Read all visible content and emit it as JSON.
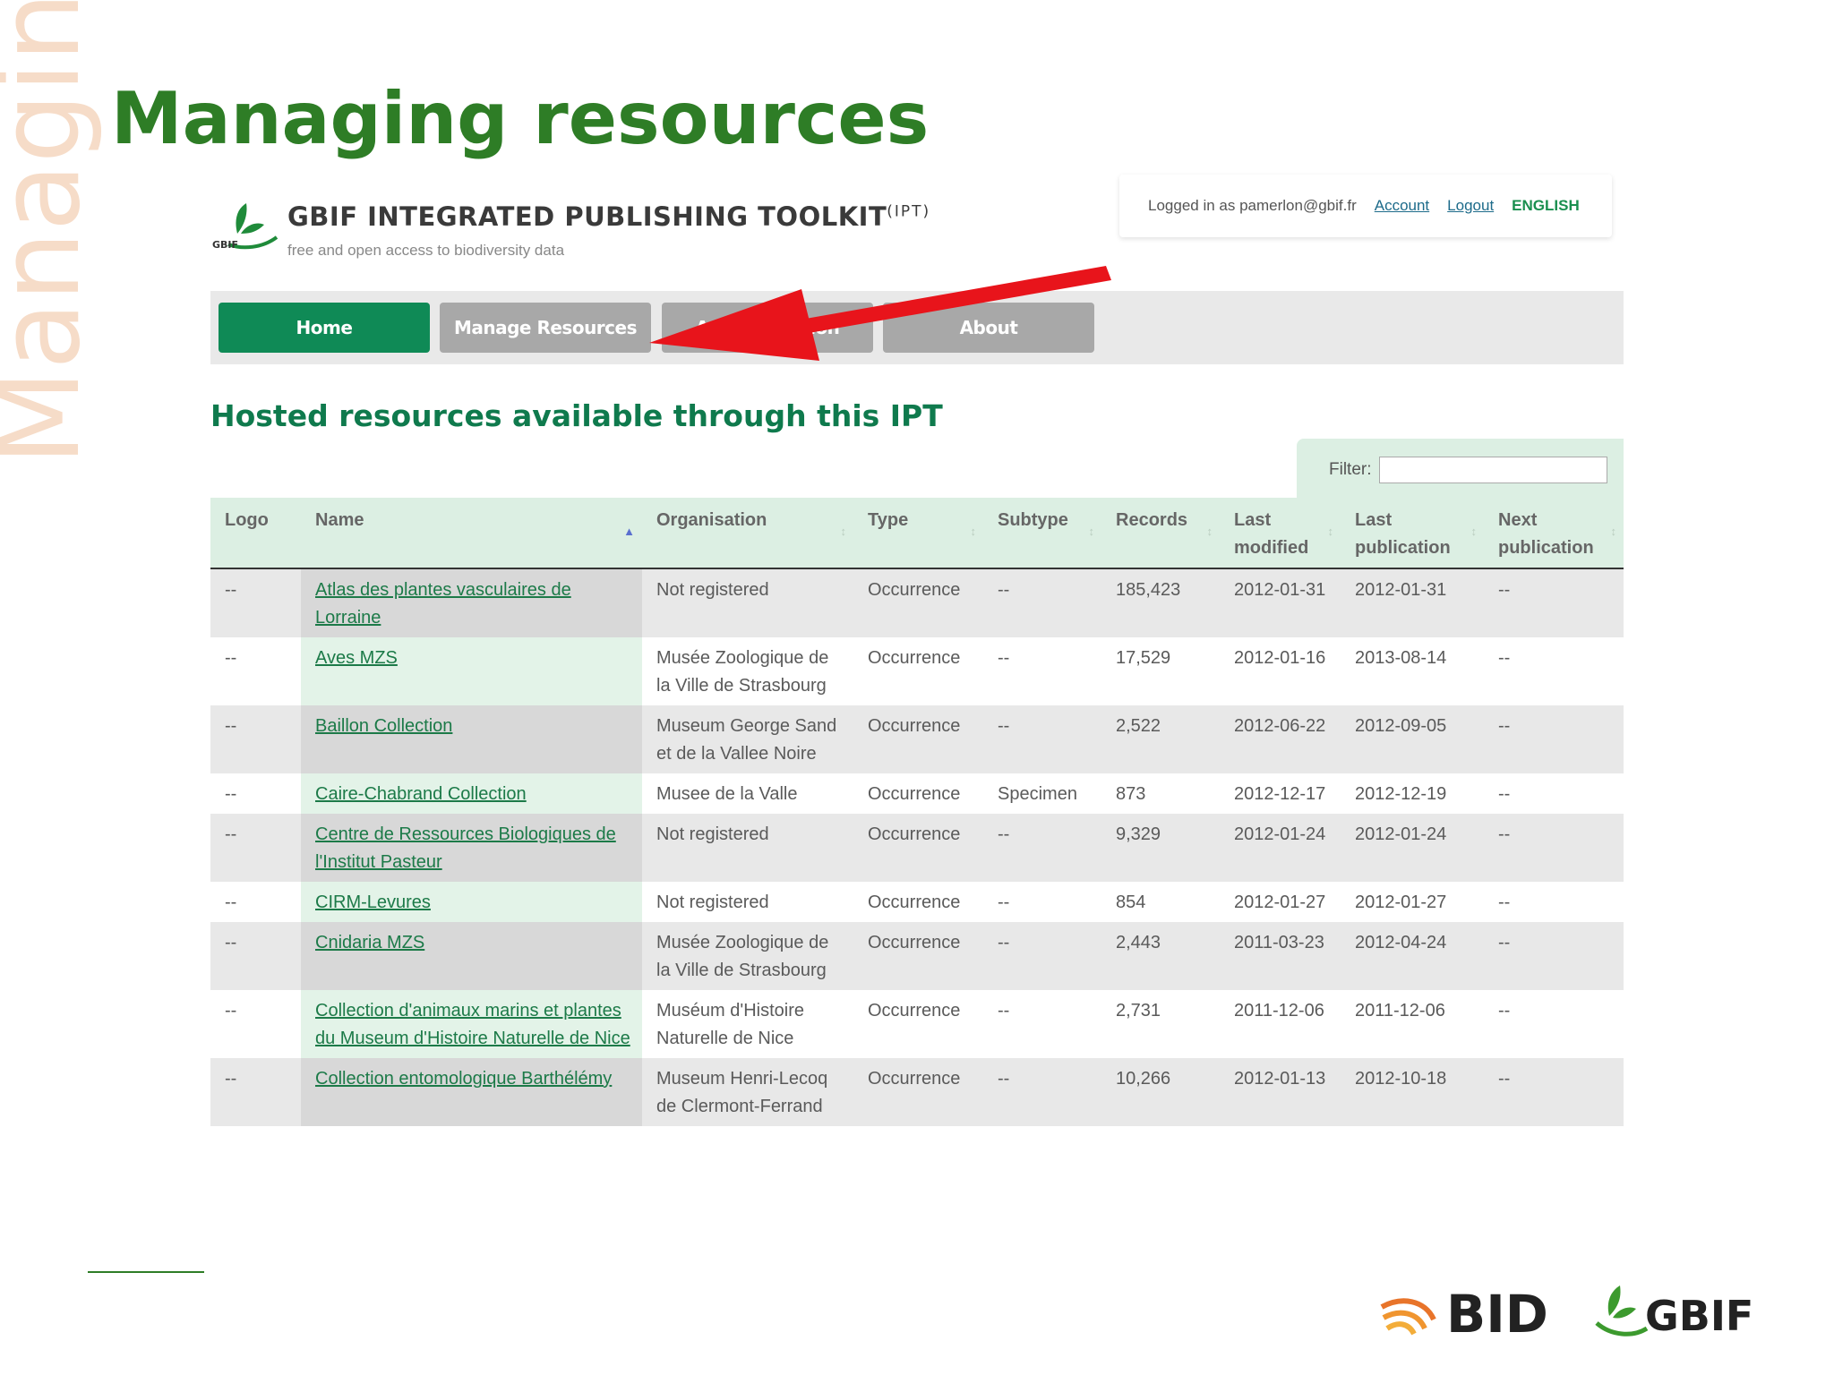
{
  "slide": {
    "vertical_word": "Managing",
    "title": "Managing resources"
  },
  "ipt": {
    "logo_text": "GBIF",
    "title": "GBIF INTEGRATED PUBLISHING TOOLKIT",
    "title_sup": "(IPT)",
    "tagline": "free and open access to biodiversity data",
    "login": {
      "logged_in_text": "Logged in as pamerlon@gbif.fr",
      "account_label": "Account",
      "logout_label": "Logout",
      "language_label": "ENGLISH"
    },
    "nav": [
      {
        "label": "Home",
        "active": true
      },
      {
        "label": "Manage Resources",
        "active": false
      },
      {
        "label": "Administration",
        "active": false
      },
      {
        "label": "About",
        "active": false
      }
    ],
    "section_heading": "Hosted resources available through this IPT",
    "filter_label": "Filter:",
    "filter_value": "",
    "table": {
      "columns": [
        "Logo",
        "Name",
        "Organisation",
        "Type",
        "Subtype",
        "Records",
        "Last modified",
        "Last publication",
        "Next publication"
      ],
      "rows": [
        {
          "logo": "--",
          "name": "Atlas des plantes vasculaires de Lorraine",
          "organisation": "Not registered",
          "type": "Occurrence",
          "subtype": "--",
          "records": "185,423",
          "last_modified": "2012-01-31",
          "last_publication": "2012-01-31",
          "next_publication": "--"
        },
        {
          "logo": "--",
          "name": "Aves MZS",
          "organisation": "Musée Zoologique de la Ville de Strasbourg",
          "type": "Occurrence",
          "subtype": "--",
          "records": "17,529",
          "last_modified": "2012-01-16",
          "last_publication": "2013-08-14",
          "next_publication": "--"
        },
        {
          "logo": "--",
          "name": "Baillon Collection",
          "organisation": "Museum George Sand et de la Vallee Noire",
          "type": "Occurrence",
          "subtype": "--",
          "records": "2,522",
          "last_modified": "2012-06-22",
          "last_publication": "2012-09-05",
          "next_publication": "--"
        },
        {
          "logo": "--",
          "name": "Caire-Chabrand Collection",
          "organisation": "Musee de la Valle",
          "type": "Occurrence",
          "subtype": "Specimen",
          "records": "873",
          "last_modified": "2012-12-17",
          "last_publication": "2012-12-19",
          "next_publication": "--"
        },
        {
          "logo": "--",
          "name": "Centre de Ressources Biologiques de l'Institut Pasteur",
          "organisation": "Not registered",
          "type": "Occurrence",
          "subtype": "--",
          "records": "9,329",
          "last_modified": "2012-01-24",
          "last_publication": "2012-01-24",
          "next_publication": "--"
        },
        {
          "logo": "--",
          "name": "CIRM-Levures",
          "organisation": "Not registered",
          "type": "Occurrence",
          "subtype": "--",
          "records": "854",
          "last_modified": "2012-01-27",
          "last_publication": "2012-01-27",
          "next_publication": "--"
        },
        {
          "logo": "--",
          "name": "Cnidaria MZS",
          "organisation": "Musée Zoologique de la Ville de Strasbourg",
          "type": "Occurrence",
          "subtype": "--",
          "records": "2,443",
          "last_modified": "2011-03-23",
          "last_publication": "2012-04-24",
          "next_publication": "--"
        },
        {
          "logo": "--",
          "name": "Collection d'animaux marins et plantes du Museum d'Histoire Naturelle de Nice",
          "organisation": "Muséum d'Histoire Naturelle de Nice",
          "type": "Occurrence",
          "subtype": "--",
          "records": "2,731",
          "last_modified": "2011-12-06",
          "last_publication": "2011-12-06",
          "next_publication": "--"
        },
        {
          "logo": "--",
          "name": "Collection entomologique Barthélémy",
          "organisation": "Museum Henri-Lecoq de Clermont-Ferrand",
          "type": "Occurrence",
          "subtype": "--",
          "records": "10,266",
          "last_modified": "2012-01-13",
          "last_publication": "2012-10-18",
          "next_publication": "--"
        }
      ]
    }
  },
  "footer": {
    "bid_logo_text": "BID",
    "gbif_logo_text": "GBIF"
  },
  "colors": {
    "title_green": "#2e7d26",
    "nav_active": "#0f8a56",
    "nav_inactive": "#a8a8a8",
    "heading_green": "#0f7a4d",
    "link_green": "#1c7a48",
    "arrow_red": "#e8141b",
    "header_bg": "#dcefe3"
  }
}
